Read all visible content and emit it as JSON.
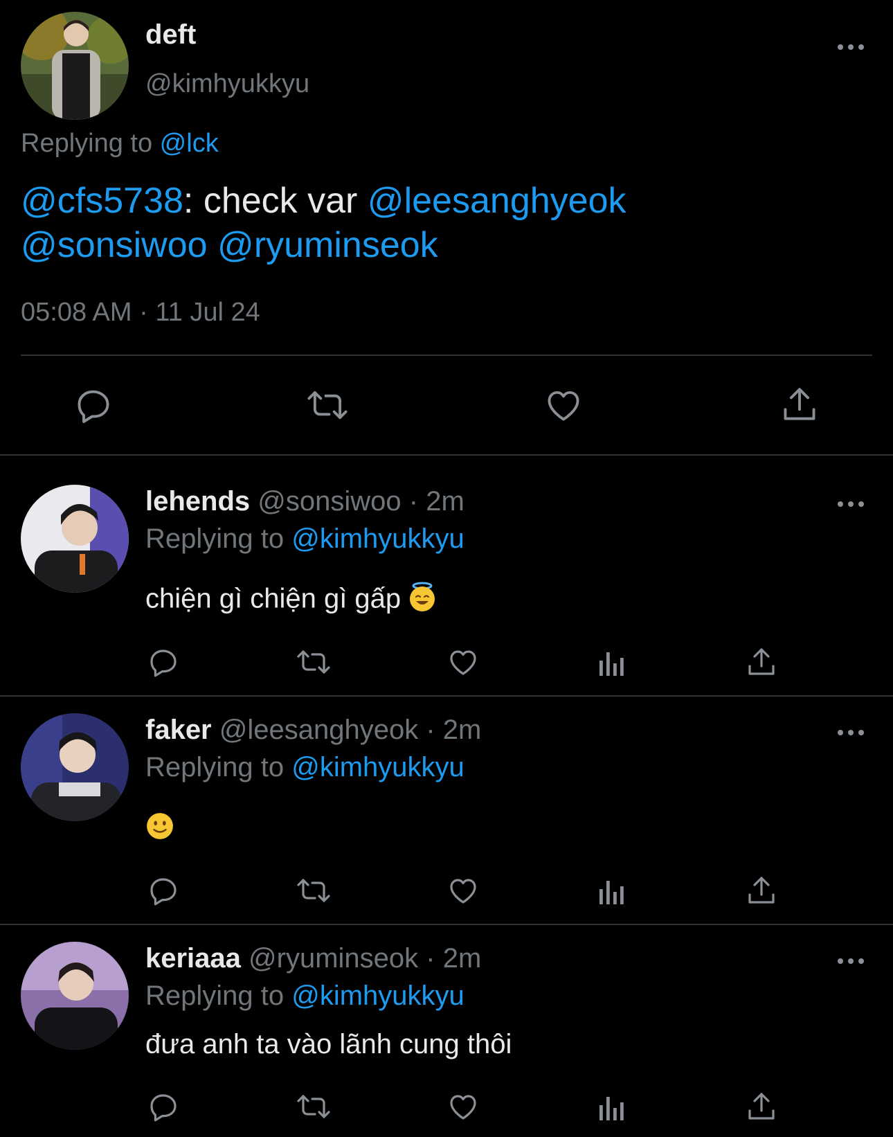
{
  "main_tweet": {
    "name": "deft",
    "handle": "@kimhyukkyu",
    "replying_prefix": "Replying to ",
    "replying_target": "@lck",
    "text_mention_1": "@cfs5738",
    "text_mid": ": check var ",
    "text_mention_2": "@leesanghyeok",
    "text_mention_3": "@sonsiwoo",
    "text_mention_4": "@ryuminseok",
    "timestamp": "05:08 AM · 11 Jul 24",
    "actions": [
      "reply-icon",
      "retweet-icon",
      "like-icon",
      "share-icon"
    ]
  },
  "replies": [
    {
      "name": "lehends",
      "handle": "@sonsiwoo",
      "time": "· 2m",
      "replying_prefix": "Replying to ",
      "replying_target": "@kimhyukkyu",
      "text": "chiện gì chiện gì gấp",
      "emoji": "smiling-face-with-halo"
    },
    {
      "name": "faker",
      "handle": "@leesanghyeok",
      "time": "· 2m",
      "replying_prefix": "Replying to ",
      "replying_target": "@kimhyukkyu",
      "text": "",
      "emoji": "slightly-smiling-face"
    },
    {
      "name": "keriaaa",
      "handle": "@ryuminseok",
      "time": "· 2m",
      "replying_prefix": "Replying to ",
      "replying_target": "@kimhyukkyu",
      "text": "đưa anh ta vào lãnh cung thôi",
      "emoji": ""
    }
  ],
  "reply_actions": [
    "reply-icon",
    "retweet-icon",
    "like-icon",
    "views-icon",
    "share-icon"
  ],
  "colors": {
    "background": "#000000",
    "text": "#e7e9ea",
    "muted": "#71767b",
    "link": "#1d9bf0",
    "divider": "#2f3336"
  }
}
